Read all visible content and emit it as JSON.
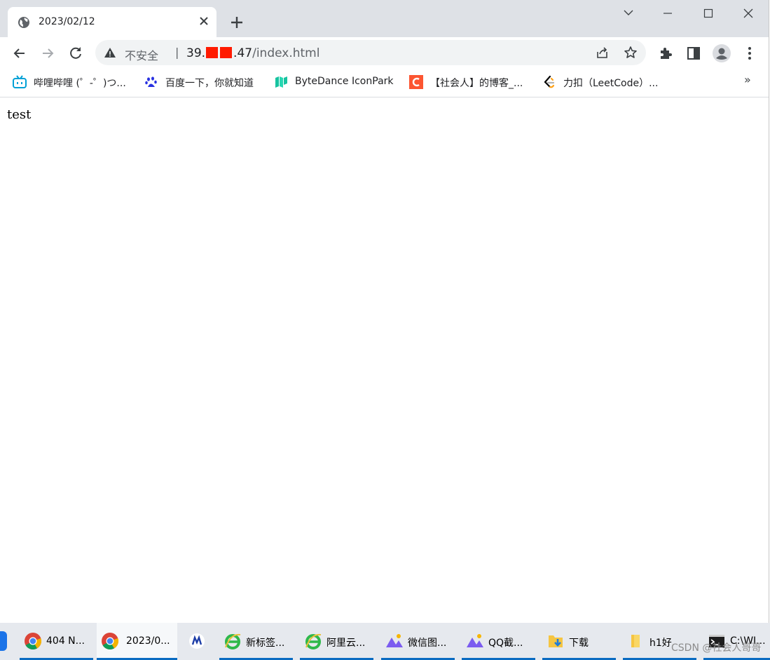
{
  "tab": {
    "title": "2023/02/12"
  },
  "omnibox": {
    "security": "不安全",
    "separator": "|",
    "url_host_prefix": "39.",
    "url_host_suffix": ".47",
    "url_path": "/index.html"
  },
  "bookmarks": [
    {
      "label": "哔哩哔哩 (゜-゜)つ...",
      "icon": "bilibili-icon"
    },
    {
      "label": "百度一下，你就知道",
      "icon": "baidu-paw-icon"
    },
    {
      "label": "ByteDance IconPark",
      "icon": "iconpark-icon"
    },
    {
      "label": "【社会人】的博客_...",
      "icon": "csdn-icon"
    },
    {
      "label": "力扣（LeetCode）...",
      "icon": "leetcode-icon"
    }
  ],
  "bookmarks_more": "»",
  "page": {
    "text": "test"
  },
  "taskbar": [
    {
      "label": "404 N...",
      "icon": "chrome-icon"
    },
    {
      "label": "2023/0...",
      "icon": "chrome-icon"
    },
    {
      "label": "",
      "icon": "app-icon"
    },
    {
      "label": "新标签...",
      "icon": "ie-icon"
    },
    {
      "label": "阿里云...",
      "icon": "ie-icon"
    },
    {
      "label": "微信图...",
      "icon": "image-app-icon"
    },
    {
      "label": "QQ截...",
      "icon": "image-app-icon"
    },
    {
      "label": "下载",
      "icon": "folder-download-icon"
    },
    {
      "label": "h1好",
      "icon": "folder-icon"
    },
    {
      "label": "C:\\WI...",
      "icon": "cmd-icon"
    }
  ],
  "watermark": "CSDN @社会人哥哥",
  "colors": {
    "tabstrip": "#dee1e6",
    "taskbar_accent": "#0a6bc1",
    "redaction": "#ff1a00"
  }
}
